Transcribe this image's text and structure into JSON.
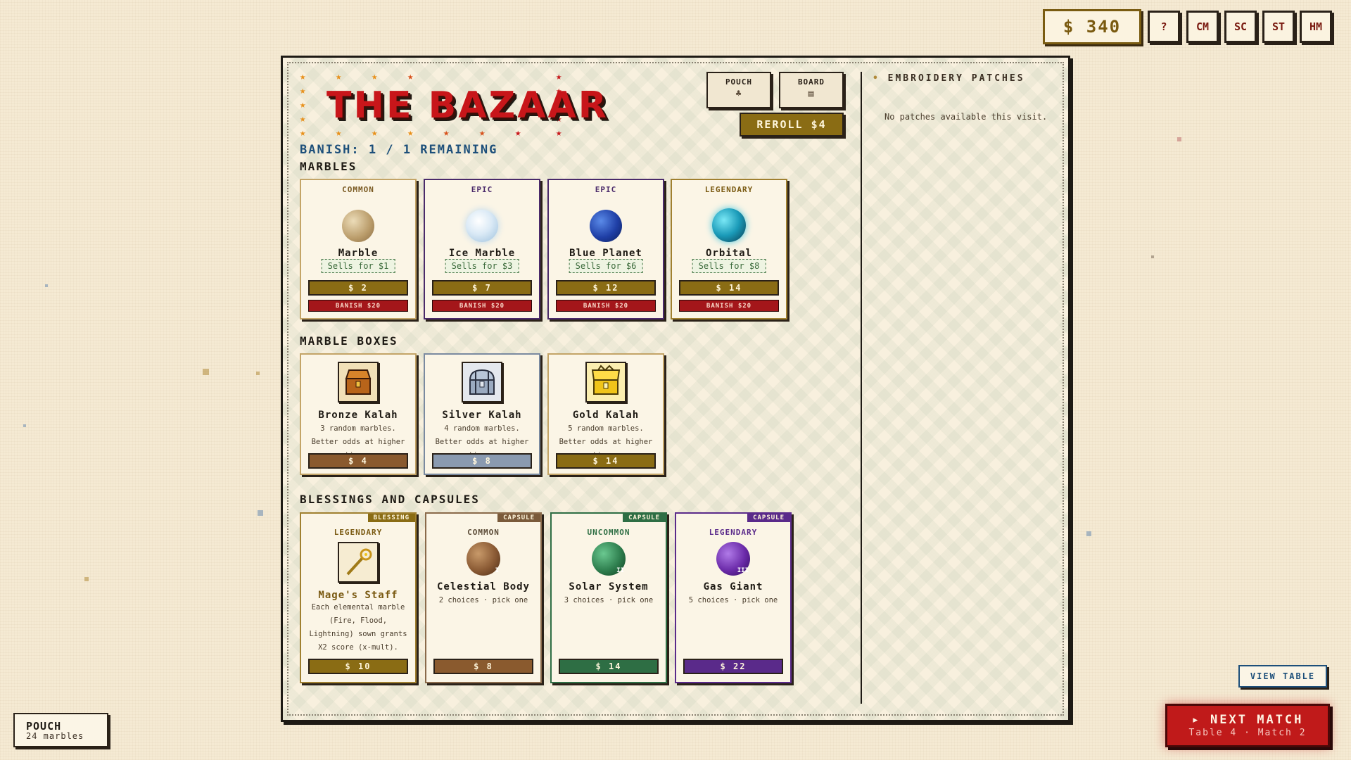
{
  "money": "$ 340",
  "top_buttons": [
    "?",
    "CM",
    "SC",
    "ST",
    "HM"
  ],
  "shop": {
    "title": "THE BAZAAR",
    "banish_count": "BANISH: 1 / 1 REMAINING",
    "pouch_label": "POUCH",
    "board_label": "BOARD",
    "reroll_label": "REROLL $4"
  },
  "sections": {
    "marbles": "MARBLES",
    "boxes": "MARBLE BOXES",
    "blessings": "BLESSINGS AND CAPSULES"
  },
  "marbles": [
    {
      "rarity": "COMMON",
      "name": "Marble",
      "sells": "Sells for $1",
      "price": "$ 2",
      "banish": "BANISH $20"
    },
    {
      "rarity": "EPIC",
      "name": "Ice Marble",
      "sells": "Sells for $3",
      "price": "$ 7",
      "banish": "BANISH $20"
    },
    {
      "rarity": "EPIC",
      "name": "Blue Planet",
      "sells": "Sells for $6",
      "price": "$ 12",
      "banish": "BANISH $20"
    },
    {
      "rarity": "LEGENDARY",
      "name": "Orbital",
      "sells": "Sells for $8",
      "price": "$ 14",
      "banish": "BANISH $20"
    }
  ],
  "boxes": [
    {
      "name": "Bronze Kalah",
      "desc": "3 random marbles. Better odds at higher tiers.",
      "price": "$ 4",
      "icon": "bronze-chest"
    },
    {
      "name": "Silver Kalah",
      "desc": "4 random marbles. Better odds at higher tiers.",
      "price": "$ 8",
      "icon": "silver-chest"
    },
    {
      "name": "Gold Kalah",
      "desc": "5 random marbles. Better odds at higher tiers.",
      "price": "$ 14",
      "icon": "gold-chest"
    }
  ],
  "blessings": [
    {
      "tag": "BLESSING",
      "rarity": "LEGENDARY",
      "name": "Mage's Staff",
      "desc": "Each elemental marble (Fire, Flood, Lightning) sown grants X2 score (x-mult).",
      "price": "$ 10"
    },
    {
      "tag": "CAPSULE",
      "rarity": "COMMON",
      "name": "Celestial Body",
      "desc": "2 choices · pick one",
      "price": "$ 8",
      "roman": "I"
    },
    {
      "tag": "CAPSULE",
      "rarity": "UNCOMMON",
      "name": "Solar System",
      "desc": "3 choices · pick one",
      "price": "$ 14",
      "roman": "II"
    },
    {
      "tag": "CAPSULE",
      "rarity": "LEGENDARY",
      "name": "Gas Giant",
      "desc": "5 choices · pick one",
      "price": "$ 22",
      "roman": "III"
    }
  ],
  "patches": {
    "title": "EMBROIDERY PATCHES",
    "empty": "No patches available this visit."
  },
  "pouch": {
    "label": "POUCH",
    "count": "24 marbles"
  },
  "view_table": "VIEW TABLE",
  "next_match": {
    "label": "▸ NEXT MATCH",
    "sub": "Table 4 · Match 2"
  },
  "colors": {
    "accent_red": "#c01a1a",
    "gold": "#8a6c14",
    "epic_purple": "#4a2a6a",
    "uncommon_green": "#2e6e44",
    "blue_text": "#1d4f7a"
  }
}
